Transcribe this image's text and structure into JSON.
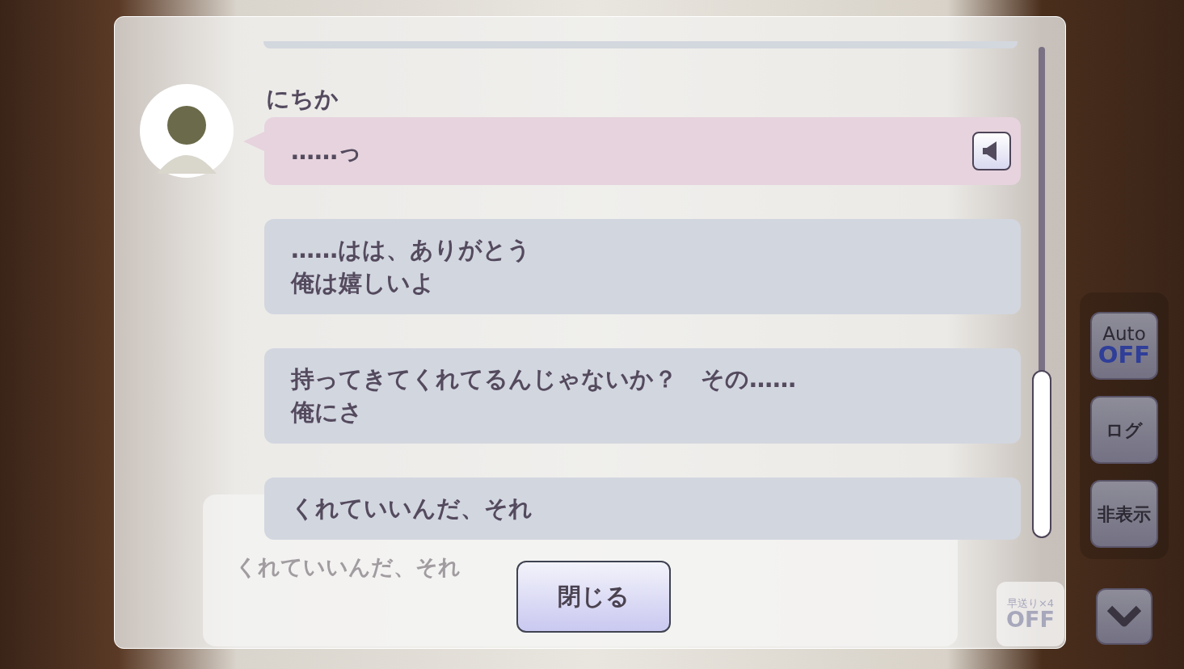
{
  "background": {
    "dialog_text": "くれていいんだ、それ",
    "fast_forward": {
      "label": "早送り×4",
      "value": "OFF"
    }
  },
  "log": {
    "messages": [
      {
        "kind": "voiced",
        "speaker": "にちか",
        "lines": [
          "……っ"
        ]
      },
      {
        "kind": "plain",
        "lines": [
          "……はは、ありがとう",
          "俺は嬉しいよ"
        ]
      },
      {
        "kind": "plain",
        "lines": [
          "持ってきてくれてるんじゃないか？　その……",
          "俺にさ"
        ]
      },
      {
        "kind": "plain",
        "lines": [
          "くれていいんだ、それ"
        ]
      }
    ],
    "close_button": "閉じる"
  },
  "side_buttons": [
    {
      "kind": "toggle",
      "label": "Auto",
      "value": "OFF"
    },
    {
      "kind": "text",
      "label": "ログ"
    },
    {
      "kind": "text",
      "label": "非表示"
    },
    {
      "kind": "chevron"
    }
  ]
}
